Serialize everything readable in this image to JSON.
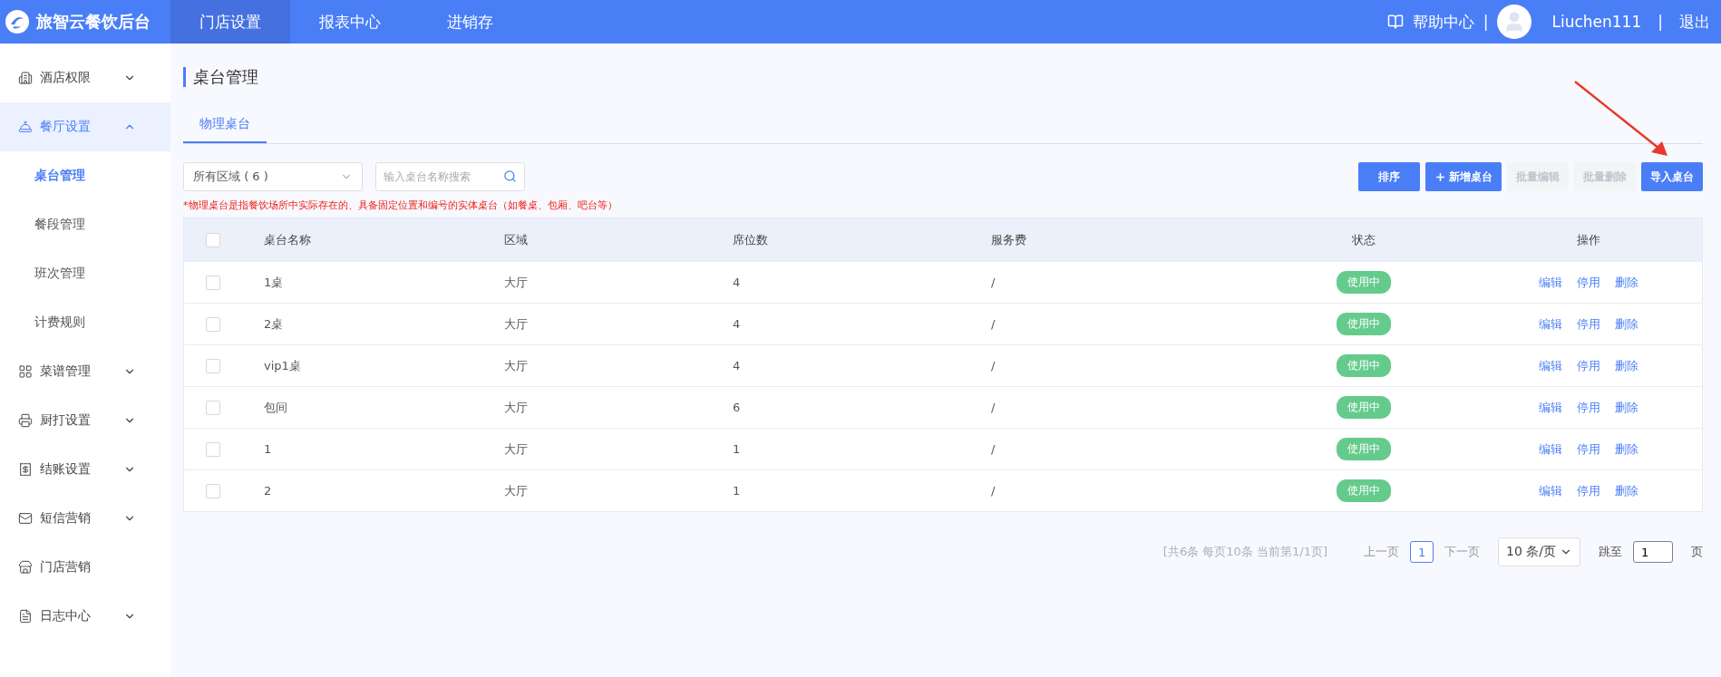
{
  "header": {
    "brand": "旅智云餐饮后台",
    "nav": [
      {
        "label": "门店设置",
        "selected": true
      },
      {
        "label": "报表中心",
        "selected": false
      },
      {
        "label": "进销存",
        "selected": false
      }
    ],
    "help": "帮助中心",
    "separator_1": "|",
    "user": "Liuchen111",
    "separator_2": "|",
    "logout": "退出"
  },
  "sidebar": {
    "items": [
      {
        "label": "酒店权限",
        "kind": "group",
        "expanded": false,
        "selected": false
      },
      {
        "label": "餐厅设置",
        "kind": "group",
        "expanded": true,
        "selected": true,
        "children": [
          {
            "label": "桌台管理",
            "selected": true
          },
          {
            "label": "餐段管理",
            "selected": false
          },
          {
            "label": "班次管理",
            "selected": false
          },
          {
            "label": "计费规则",
            "selected": false
          }
        ]
      },
      {
        "label": "菜谱管理",
        "kind": "group",
        "expanded": false,
        "selected": false
      },
      {
        "label": "厨打设置",
        "kind": "group",
        "expanded": false,
        "selected": false
      },
      {
        "label": "结账设置",
        "kind": "group",
        "expanded": false,
        "selected": false
      },
      {
        "label": "短信营销",
        "kind": "group",
        "expanded": false,
        "selected": false
      },
      {
        "label": "门店营销",
        "kind": "link",
        "selected": false
      },
      {
        "label": "日志中心",
        "kind": "group",
        "expanded": false,
        "selected": false
      }
    ]
  },
  "page": {
    "title": "桌台管理",
    "tabs": [
      {
        "label": "物理桌台",
        "selected": true
      }
    ],
    "area_select": "所有区域 ( 6 )",
    "search": {
      "placeholder": "输入桌台名称搜索"
    },
    "buttons": [
      {
        "label": "排序",
        "kind": "plain",
        "disabled": false
      },
      {
        "label": "新增桌台",
        "kind": "add",
        "disabled": false
      },
      {
        "label": "批量编辑",
        "kind": "plain",
        "disabled": true
      },
      {
        "label": "批量删除",
        "kind": "plain",
        "disabled": true
      },
      {
        "label": "导入桌台",
        "kind": "plain",
        "disabled": false
      }
    ],
    "note": "*物理桌台是指餐饮场所中实际存在的、具备固定位置和编号的实体桌台（如餐桌、包厢、吧台等）",
    "table": {
      "all_checked": false,
      "columns": [
        "桌台名称",
        "区域",
        "席位数",
        "服务费",
        "状态",
        "操作"
      ],
      "rows": [
        {
          "checked": false,
          "name": "1桌",
          "area": "大厅",
          "seats": "4",
          "fee": "/",
          "status": "使用中",
          "actions": [
            "编辑",
            "停用",
            "删除"
          ]
        },
        {
          "checked": false,
          "name": "2桌",
          "area": "大厅",
          "seats": "4",
          "fee": "/",
          "status": "使用中",
          "actions": [
            "编辑",
            "停用",
            "删除"
          ]
        },
        {
          "checked": false,
          "name": "vip1桌",
          "area": "大厅",
          "seats": "4",
          "fee": "/",
          "status": "使用中",
          "actions": [
            "编辑",
            "停用",
            "删除"
          ]
        },
        {
          "checked": false,
          "name": "包间",
          "area": "大厅",
          "seats": "6",
          "fee": "/",
          "status": "使用中",
          "actions": [
            "编辑",
            "停用",
            "删除"
          ]
        },
        {
          "checked": false,
          "name": "1",
          "area": "大厅",
          "seats": "1",
          "fee": "/",
          "status": "使用中",
          "actions": [
            "编辑",
            "停用",
            "删除"
          ]
        },
        {
          "checked": false,
          "name": "2",
          "area": "大厅",
          "seats": "1",
          "fee": "/",
          "status": "使用中",
          "actions": [
            "编辑",
            "停用",
            "删除"
          ]
        }
      ]
    },
    "pagination": {
      "summary": "[共6条 每页10条 当前第1/1页]",
      "prev": "上一页",
      "pages": [
        {
          "label": "1",
          "selected": true
        }
      ],
      "next": "下一页",
      "page_size": "10 条/页",
      "jump_label": "跳至",
      "jump_value": "1",
      "page_unit": "页"
    }
  }
}
